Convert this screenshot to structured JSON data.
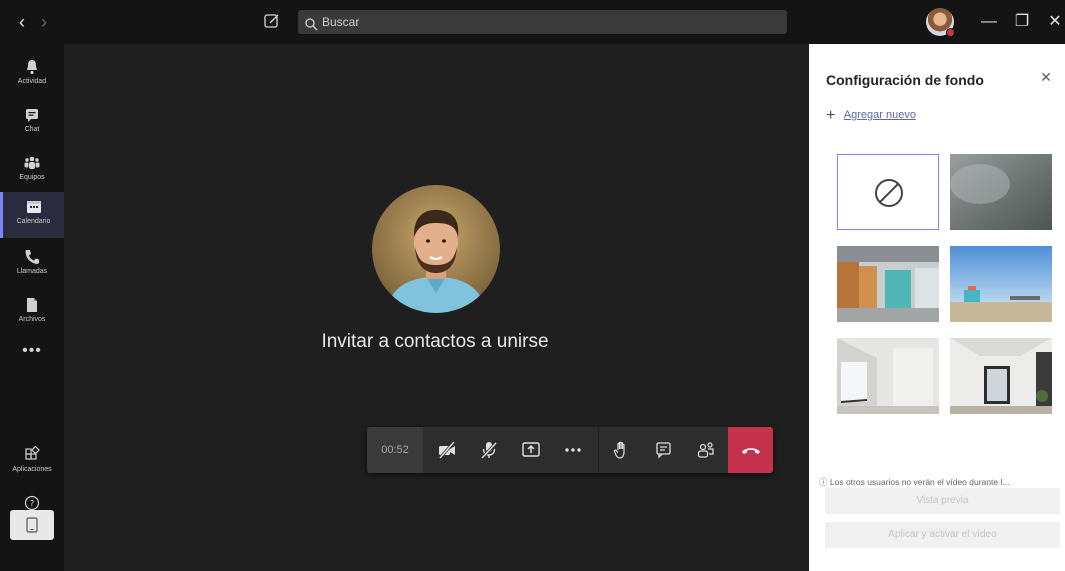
{
  "titlebar": {
    "search_placeholder": "Buscar",
    "back_icon": "chevron-left-icon",
    "forward_icon": "chevron-right-icon",
    "compose_icon": "compose-icon",
    "minimize_glyph": "—",
    "maximize_glyph": "❐",
    "close_glyph": "✕"
  },
  "rail": {
    "items": [
      {
        "label": "Actividad",
        "icon": "bell-icon"
      },
      {
        "label": "Chat",
        "icon": "chat-icon"
      },
      {
        "label": "Equipos",
        "icon": "teams-icon"
      },
      {
        "label": "Calendario",
        "icon": "calendar-icon",
        "active": true
      },
      {
        "label": "Llamadas",
        "icon": "phone-icon"
      },
      {
        "label": "Archivos",
        "icon": "file-icon"
      }
    ],
    "more_label": "•••",
    "bottom_items": [
      {
        "label": "Aplicaciones",
        "icon": "apps-icon"
      },
      {
        "label": "Ayuda",
        "icon": "help-icon"
      }
    ]
  },
  "stage": {
    "invite_text": "Invitar a contactos a unirse"
  },
  "controls": {
    "timer": "00:52"
  },
  "panel": {
    "title": "Configuración de fondo",
    "add_new": "Agregar nuevo",
    "note": "Los otros usuarios no verán el vídeo durante l...",
    "preview_button": "Vista previa",
    "apply_button": "Aplicar y activar el vídeo"
  },
  "colors": {
    "accent": "#6264a7",
    "hangup": "#c4314b",
    "rail_active": "#7f85f5"
  }
}
